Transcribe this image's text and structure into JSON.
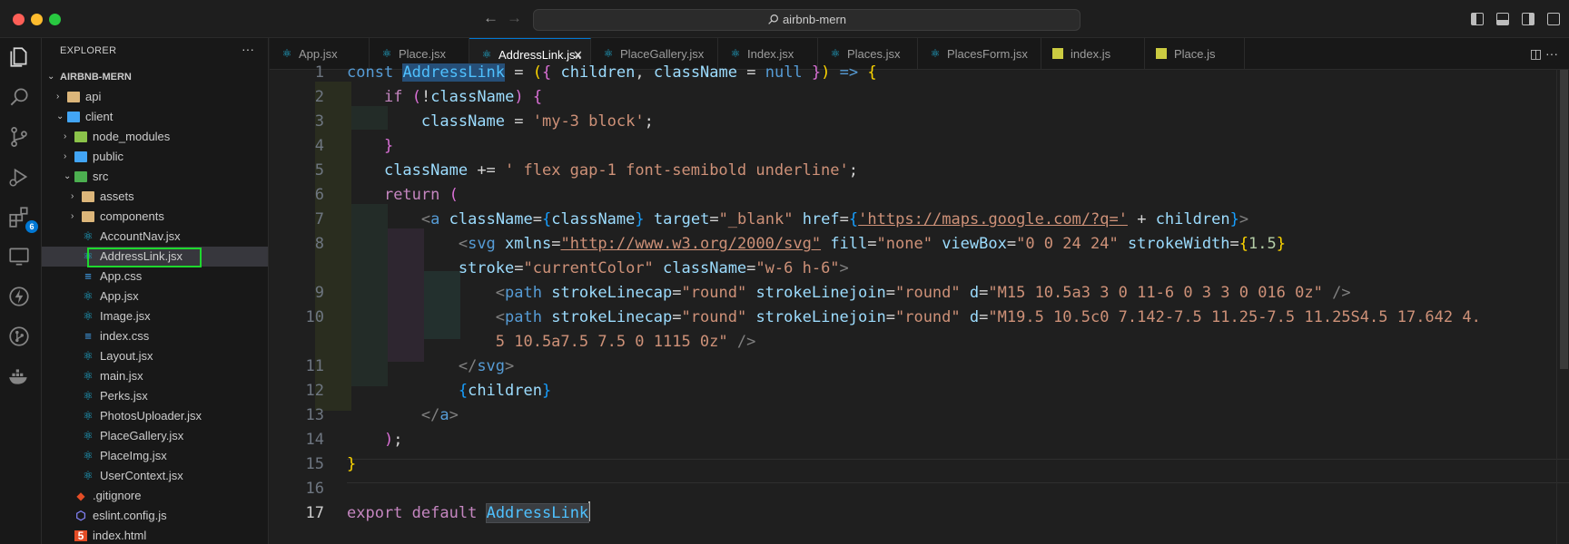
{
  "titlebar": {
    "search_text": "airbnb-mern",
    "back_icon": "arrow-left-icon",
    "forward_icon": "arrow-right-icon"
  },
  "sidebar": {
    "title": "EXPLORER",
    "more": "···",
    "root": "AIRBNB-MERN",
    "items": [
      {
        "label": "api",
        "kind": "folder",
        "depth": 1,
        "chevron": "›"
      },
      {
        "label": "client",
        "kind": "folder",
        "depth": 1,
        "chevron": "⌄"
      },
      {
        "label": "node_modules",
        "kind": "folder",
        "depth": 2,
        "chevron": "›"
      },
      {
        "label": "public",
        "kind": "folder",
        "depth": 2,
        "chevron": "›"
      },
      {
        "label": "src",
        "kind": "folder",
        "depth": 2,
        "chevron": "⌄"
      },
      {
        "label": "assets",
        "kind": "folder",
        "depth": 3,
        "chevron": "›"
      },
      {
        "label": "components",
        "kind": "folder",
        "depth": 3,
        "chevron": "›"
      },
      {
        "label": "AccountNav.jsx",
        "kind": "react",
        "depth": 3
      },
      {
        "label": "AddressLink.jsx",
        "kind": "react",
        "depth": 3
      },
      {
        "label": "App.css",
        "kind": "css",
        "depth": 3
      },
      {
        "label": "App.jsx",
        "kind": "react",
        "depth": 3
      },
      {
        "label": "Image.jsx",
        "kind": "react",
        "depth": 3
      },
      {
        "label": "index.css",
        "kind": "css",
        "depth": 3
      },
      {
        "label": "Layout.jsx",
        "kind": "react",
        "depth": 3
      },
      {
        "label": "main.jsx",
        "kind": "react",
        "depth": 3
      },
      {
        "label": "Perks.jsx",
        "kind": "react",
        "depth": 3
      },
      {
        "label": "PhotosUploader.jsx",
        "kind": "react",
        "depth": 3
      },
      {
        "label": "PlaceGallery.jsx",
        "kind": "react",
        "depth": 3
      },
      {
        "label": "PlaceImg.jsx",
        "kind": "react",
        "depth": 3
      },
      {
        "label": "UserContext.jsx",
        "kind": "react",
        "depth": 3
      },
      {
        "label": ".gitignore",
        "kind": "git",
        "depth": 2
      },
      {
        "label": "eslint.config.js",
        "kind": "eslint",
        "depth": 2
      },
      {
        "label": "index.html",
        "kind": "html",
        "depth": 2
      }
    ]
  },
  "tabs": [
    {
      "label": "App.jsx",
      "kind": "react"
    },
    {
      "label": "Place.jsx",
      "kind": "react"
    },
    {
      "label": "AddressLink.jsx",
      "kind": "react",
      "active": true,
      "close": "✕"
    },
    {
      "label": "PlaceGallery.jsx",
      "kind": "react"
    },
    {
      "label": "Index.jsx",
      "kind": "react"
    },
    {
      "label": "Places.jsx",
      "kind": "react"
    },
    {
      "label": "PlacesForm.jsx",
      "kind": "react"
    },
    {
      "label": "index.js",
      "kind": "js"
    },
    {
      "label": "Place.js",
      "kind": "js"
    }
  ],
  "editor": {
    "line_numbers": [
      "1",
      "2",
      "3",
      "4",
      "5",
      "6",
      "7",
      "8",
      "9",
      "10",
      "11",
      "12",
      "13",
      "14",
      "15",
      "16",
      "17"
    ],
    "active_line": "17"
  },
  "colors": {
    "accent": "#0078d4",
    "highlight_box": "#1ed82e",
    "badge": "#0078d4"
  },
  "activity": {
    "extensions_badge": "6"
  }
}
